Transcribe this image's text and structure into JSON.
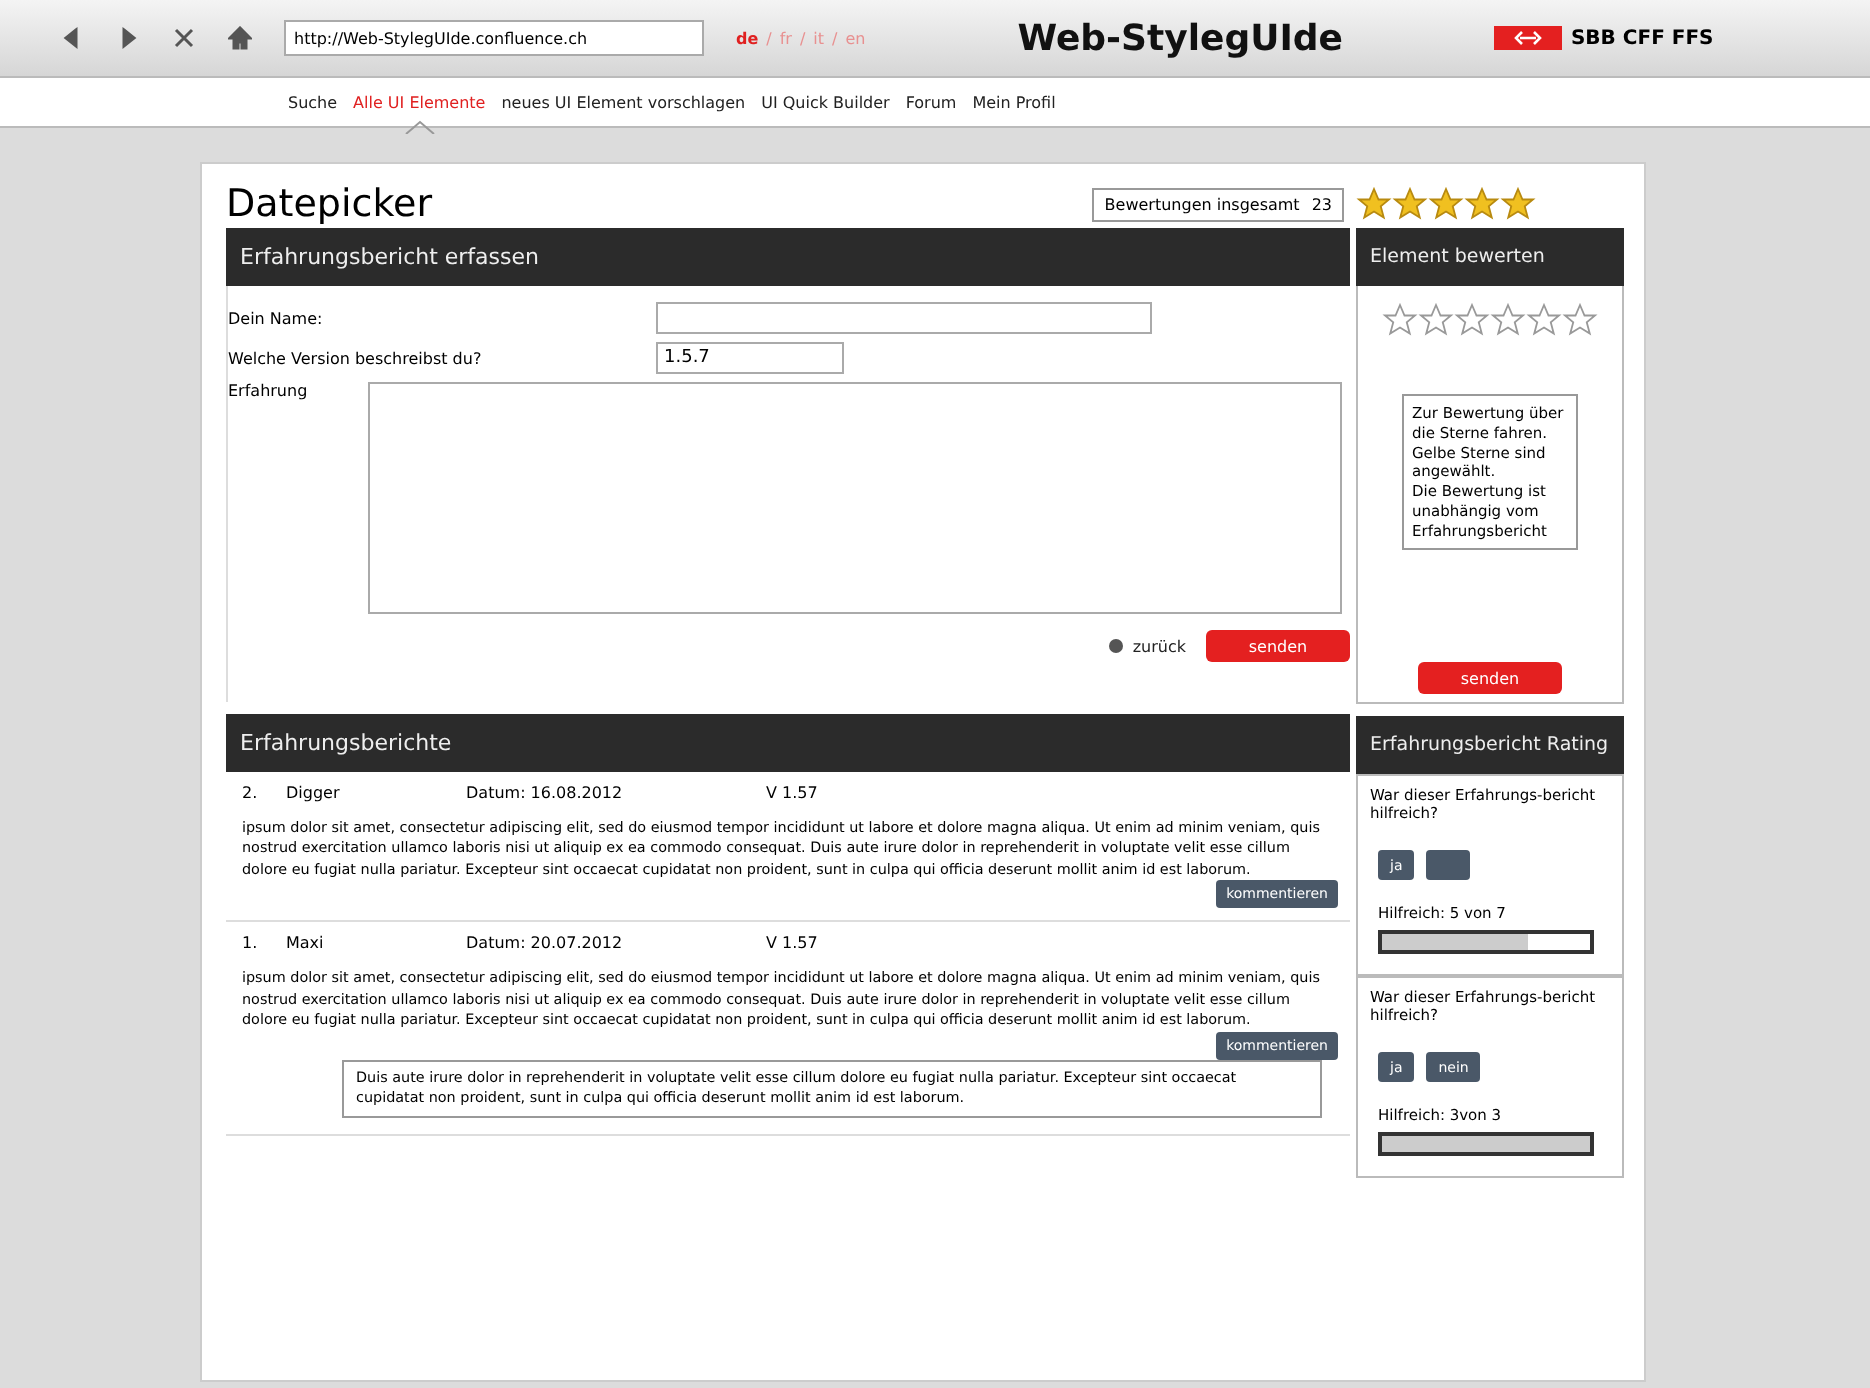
{
  "toolbar": {
    "url": "http://Web-StylegUIde.confluence.ch",
    "languages": [
      {
        "label": "de",
        "selected": true
      },
      {
        "label": "fr",
        "selected": false
      },
      {
        "label": "it",
        "selected": false
      },
      {
        "label": "en",
        "selected": false
      }
    ],
    "language_separator": "/",
    "site_title": "Web-StylegUIde",
    "brand": "SBB CFF FFS"
  },
  "nav": [
    {
      "label": "Suche",
      "selected": false
    },
    {
      "label": "Alle UI Elemente",
      "selected": true
    },
    {
      "label": "neues UI Element vorschlagen",
      "selected": false
    },
    {
      "label": "UI Quick Builder",
      "selected": false
    },
    {
      "label": "Forum",
      "selected": false
    },
    {
      "label": "Mein Profil",
      "selected": false
    }
  ],
  "page_title": "Datepicker",
  "total_label": "Bewertungen insgesamt",
  "total_value": "23",
  "stars": 5,
  "form": {
    "title": "Erfahrungsbericht erfassen",
    "name_label": "Dein Name:",
    "version_label": "Welche Version beschreibst du?",
    "version_value": "1.5.7",
    "experience_label": "Erfahrung",
    "back": "zurück",
    "send": "senden"
  },
  "rate": {
    "title": "Element bewerten",
    "stars": 0,
    "hint": "Zur Bewertung über die Sterne fahren. Gelbe Sterne sind angewählt.\nDie Bewertung ist unabhängig vom Erfahrungsbericht",
    "send": "senden"
  },
  "reports": {
    "title": "Erfahrungsberichte",
    "items": [
      {
        "number": "2.",
        "author": "Digger",
        "date": "Datum: 16.08.2012",
        "version": "V 1.57",
        "text": "ipsum dolor sit amet, consectetur adipiscing elit, sed do eiusmod tempor incididunt ut labore et dolore magna aliqua. Ut enim ad minim veniam, quis nostrud exercitation ullamco laboris nisi ut aliquip ex ea commodo consequat. Duis aute irure dolor in reprehenderit in voluptate velit esse cillum dolore eu fugiat nulla pariatur. Excepteur sint occaecat cupidatat non proident, sunt in culpa qui officia deserunt mollit anim id est laborum.",
        "comment_button": "kommentieren"
      },
      {
        "number": "1.",
        "author": "Maxi",
        "date": "Datum: 20.07.2012",
        "version": "V 1.57",
        "text": "ipsum dolor sit amet, consectetur adipiscing elit, sed do eiusmod tempor incididunt ut labore et dolore magna aliqua. Ut enim ad minim veniam, quis nostrud exercitation ullamco laboris nisi ut aliquip ex ea commodo consequat. Duis aute irure dolor in reprehenderit in voluptate velit esse cillum dolore eu fugiat nulla pariatur. Excepteur sint occaecat cupidatat non proident, sunt in culpa qui officia deserunt mollit anim id est laborum.",
        "comment_button": "kommentieren",
        "comments": [
          "Duis aute irure dolor in reprehenderit in voluptate velit esse cillum dolore eu fugiat nulla pariatur. Excepteur sint occaecat cupidatat non proident, sunt in culpa qui officia deserunt mollit anim id est laborum."
        ]
      }
    ]
  },
  "ratings": {
    "title": "Erfahrungsbericht Rating",
    "items": [
      {
        "question": "War dieser Erfahrungs-bericht hilfreich?",
        "yes": "ja",
        "helpful": "Hilfreich: 5 von 7",
        "level": 0.7
      },
      {
        "question": "War dieser Erfahrungs-bericht hilfreich?",
        "yes": "ja",
        "no": "nein",
        "helpful": "Hilfreich:  3von 3",
        "level": 1.0
      }
    ]
  }
}
